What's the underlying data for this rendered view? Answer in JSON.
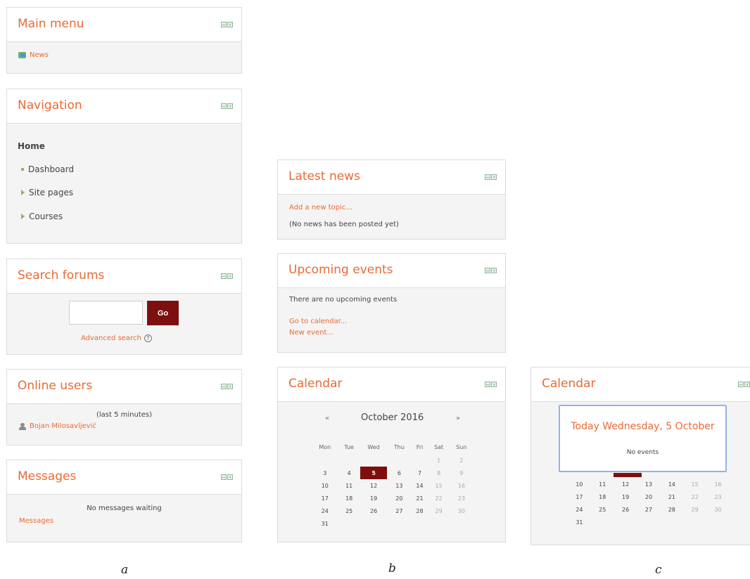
{
  "block_a": {
    "main_menu": {
      "title": "Main menu",
      "items": [
        {
          "label": "News"
        }
      ]
    },
    "navigation": {
      "title": "Navigation",
      "home": "Home",
      "items": [
        {
          "label": "Dashboard",
          "icon": "bullet"
        },
        {
          "label": "Site pages",
          "icon": "expand-arrow"
        },
        {
          "label": "Courses",
          "icon": "expand-arrow"
        }
      ]
    },
    "search_forums": {
      "title": "Search forums",
      "go_label": "Go",
      "advanced_label": "Advanced search",
      "help_glyph": "?"
    },
    "online_users": {
      "title": "Online users",
      "period": "(last 5 minutes)",
      "users": [
        "Bojan Milosavljević"
      ]
    },
    "messages": {
      "title": "Messages",
      "status": "No messages waiting",
      "link": "Messages"
    }
  },
  "block_b": {
    "latest_news": {
      "title": "Latest news",
      "add_link": "Add a new topic...",
      "status": "(No news has been posted yet)"
    },
    "upcoming_events": {
      "title": "Upcoming events",
      "status": "There are no upcoming events",
      "calendar_link": "Go to calendar...",
      "new_event_link": "New event..."
    },
    "calendar": {
      "title": "Calendar",
      "prev": "«",
      "next": "»",
      "month": "October 2016",
      "weekdays": [
        "Mon",
        "Tue",
        "Wed",
        "Thu",
        "Fri",
        "Sat",
        "Sun"
      ],
      "weeks": [
        [
          "",
          "",
          "",
          "",
          "",
          "1",
          "2"
        ],
        [
          "3",
          "4",
          "5",
          "6",
          "7",
          "8",
          "9"
        ],
        [
          "10",
          "11",
          "12",
          "13",
          "14",
          "15",
          "16"
        ],
        [
          "17",
          "18",
          "19",
          "20",
          "21",
          "22",
          "23"
        ],
        [
          "24",
          "25",
          "26",
          "27",
          "28",
          "29",
          "30"
        ],
        [
          "31",
          "",
          "",
          "",
          "",
          "",
          ""
        ]
      ],
      "today": "5",
      "today_color": "#7e0f0f"
    }
  },
  "block_c": {
    "calendar": {
      "title": "Calendar",
      "popup_title": "Today Wednesday, 5 October",
      "popup_body": "No events",
      "visible_weeks": [
        [
          "10",
          "11",
          "12",
          "13",
          "14",
          "15",
          "16"
        ],
        [
          "17",
          "18",
          "19",
          "20",
          "21",
          "22",
          "23"
        ],
        [
          "24",
          "25",
          "26",
          "27",
          "28",
          "29",
          "30"
        ],
        [
          "31",
          "",
          "",
          "",
          "",
          "",
          ""
        ]
      ]
    }
  },
  "captions": {
    "a": "a",
    "b": "b",
    "c": "c"
  },
  "colors": {
    "accent": "#e86a34",
    "go_button": "#7e0f0f",
    "popup_border": "#93b3e6"
  }
}
